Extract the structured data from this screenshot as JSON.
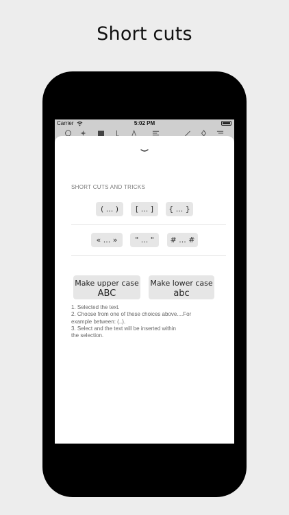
{
  "headline": "Short cuts",
  "status": {
    "carrier": "Carrier",
    "time": "5:02 PM"
  },
  "sheet": {
    "section_title": "SHORT CUTS AND TRICKS",
    "row1": [
      "( ... )",
      "[ ... ]",
      "{ ... }"
    ],
    "row2": [
      "« ... »",
      "\" ... \"",
      "# ... #"
    ],
    "upper": {
      "line1": "Make upper case",
      "line2": "ABC"
    },
    "lower": {
      "line1": "Make lower case",
      "line2": "abc"
    },
    "instructions": [
      "1. Selected the text.",
      "2. Choose from one of these choices above....For",
      "example between: (..).",
      "3. Select and the text will be inserted within",
      "the selection."
    ]
  },
  "icons": [
    "wifi-icon",
    "battery-icon",
    "chevron-down-icon",
    "emoji-icon",
    "sparkle-icon",
    "calendar-icon",
    "text-size-icon",
    "align-icon",
    "pencil-icon",
    "share-icon",
    "menu-icon"
  ]
}
